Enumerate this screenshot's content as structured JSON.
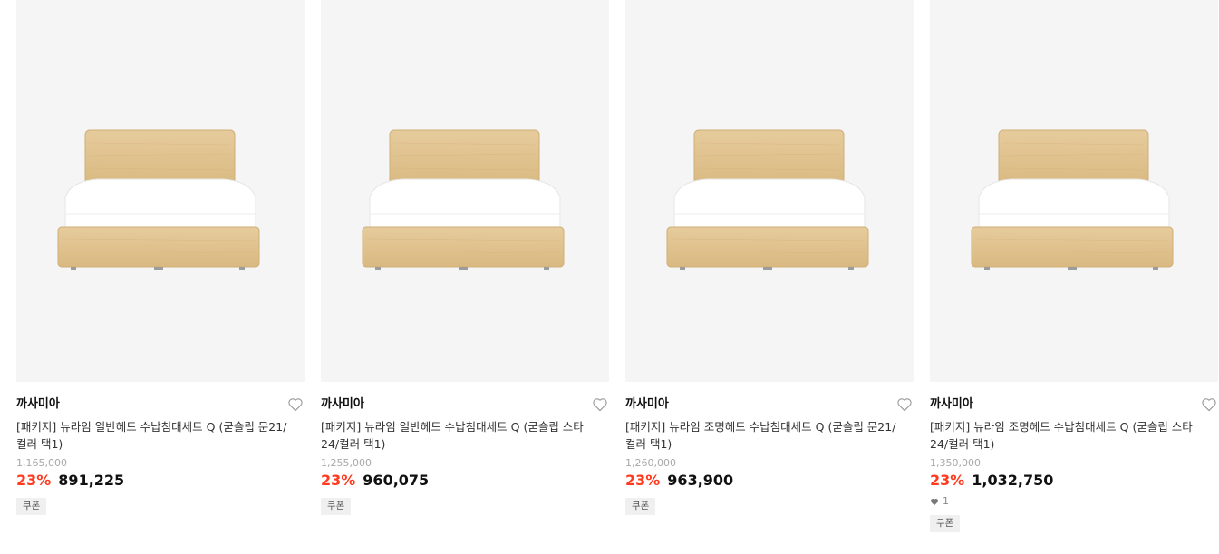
{
  "products": [
    {
      "brand": "까사미아",
      "title": "[패키지] 뉴라임 일반헤드 수납침대세트 Q (굳슬립 문21/컬러 택1)",
      "original_price": "1,165,000",
      "discount": "23%",
      "price": "891,225",
      "coupon": "쿠폰",
      "image_icon": "bed-image",
      "liked": false
    },
    {
      "brand": "까사미아",
      "title": "[패키지] 뉴라임 일반헤드 수납침대세트 Q (굳슬립 스타24/컬러 택1)",
      "original_price": "1,255,000",
      "discount": "23%",
      "price": "960,075",
      "coupon": "쿠폰",
      "image_icon": "bed-image",
      "liked": false
    },
    {
      "brand": "까사미아",
      "title": "[패키지] 뉴라임 조명헤드 수납침대세트 Q (굳슬립 문21/컬러 택1)",
      "original_price": "1,260,000",
      "discount": "23%",
      "price": "963,900",
      "coupon": "쿠폰",
      "image_icon": "bed-image",
      "liked": false
    },
    {
      "brand": "까사미아",
      "title": "[패키지] 뉴라임 조명헤드 수납침대세트 Q (굳슬립 스타24/컬러 택1)",
      "original_price": "1,350,000",
      "discount": "23%",
      "price": "1,032,750",
      "likes": "1",
      "coupon": "쿠폰",
      "image_icon": "bed-image",
      "liked": false
    }
  ],
  "colors": {
    "discount": "#ff3a1f",
    "thumb_bg": "#f5f5f5",
    "wood": "#e2c594",
    "mattress": "#ffffff"
  }
}
